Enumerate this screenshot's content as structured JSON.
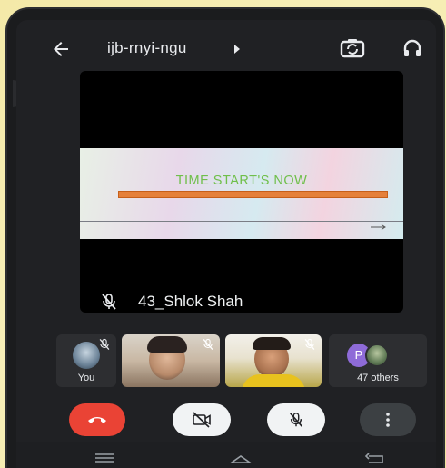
{
  "header": {
    "meeting_code": "ijb-rnyi-ngu",
    "back_icon": "arrow-left-icon",
    "switch_camera_icon": "camera-switch-icon",
    "audio_icon": "headphones-icon"
  },
  "main_tile": {
    "presenter_name": "43_Shlok Shah",
    "slide_text": "TIME START'S NOW",
    "slide_text_color": "#6fbf4a",
    "slide_bar_color": "#e5803a"
  },
  "participants": {
    "you_label": "You",
    "others_badge": "P",
    "others_label": "47 others",
    "others_badge_color": "#8e6bd8"
  },
  "controls": {
    "end_call_color": "#ea4335",
    "end_call_icon": "phone-hangup-icon",
    "camera_icon": "video-off-icon",
    "mic_icon": "mic-off-icon",
    "more_icon": "more-vertical-icon"
  },
  "navigation": {
    "menu_icon": "menu-icon",
    "home_icon": "home-icon",
    "back_icon": "back-icon"
  }
}
